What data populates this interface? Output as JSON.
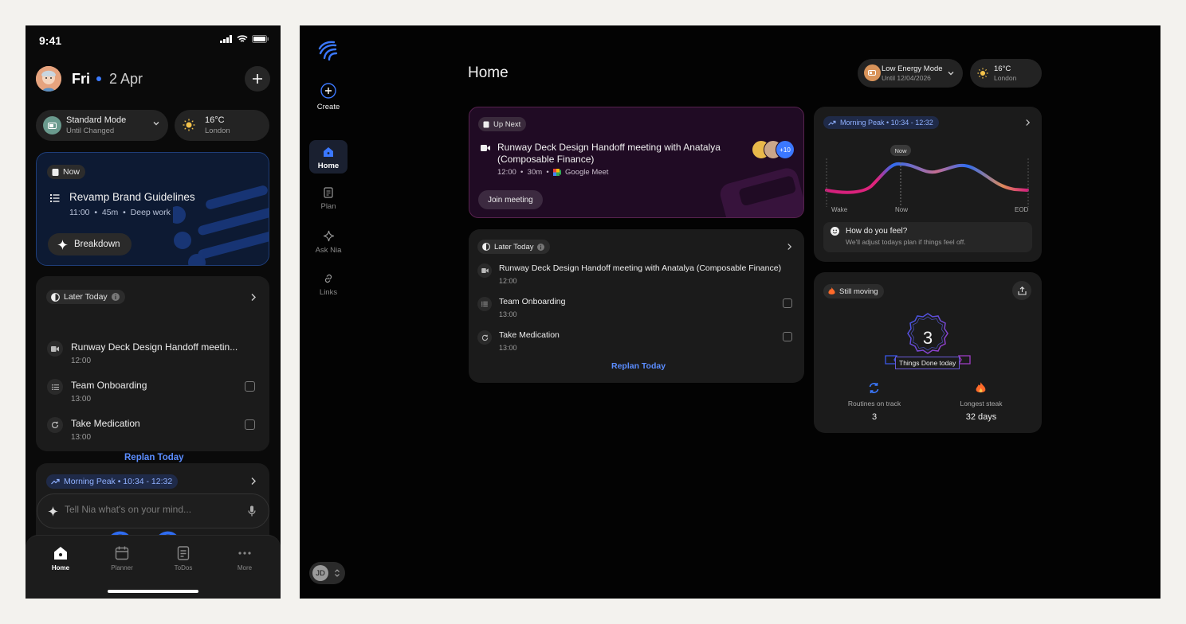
{
  "mobile": {
    "status": {
      "time": "9:41"
    },
    "header": {
      "day": "Fri",
      "date": "2 Apr"
    },
    "mode": {
      "label": "Standard Mode",
      "sub": "Until Changed"
    },
    "weather": {
      "temp": "16°C",
      "city": "London"
    },
    "now_card": {
      "tag": "Now",
      "title": "Revamp Brand Guidelines",
      "time": "11:00",
      "duration": "45m",
      "category": "Deep work",
      "button": "Breakdown"
    },
    "later": {
      "tag": "Later Today",
      "items": [
        {
          "title": "Runway Deck Design Handoff meetin...",
          "time": "12:00"
        },
        {
          "title": "Team Onboarding",
          "time": "13:00"
        },
        {
          "title": "Take Medication",
          "time": "13:00"
        }
      ],
      "replan": "Replan Today"
    },
    "peak": {
      "tag": "Morning Peak • 10:34 - 12:32"
    },
    "input": {
      "placeholder": "Tell Nia what's on your mind..."
    },
    "tabs": [
      {
        "label": "Home"
      },
      {
        "label": "Planner"
      },
      {
        "label": "ToDos"
      },
      {
        "label": "More"
      }
    ]
  },
  "desktop": {
    "nav": {
      "create": "Create",
      "items": [
        {
          "label": "Home"
        },
        {
          "label": "Plan"
        },
        {
          "label": "Ask Nia"
        },
        {
          "label": "Links"
        }
      ],
      "user_initials": "JD"
    },
    "page_title": "Home",
    "mode": {
      "label": "Low Energy Mode",
      "sub": "Until 12/04/2026"
    },
    "weather": {
      "temp": "16°C",
      "city": "London"
    },
    "up_next": {
      "tag": "Up Next",
      "title_line1": "Runway Deck Design Handoff meeting with Anatalya",
      "title_line2": "(Composable Finance)",
      "time": "12:00",
      "duration": "30m",
      "platform": "Google Meet",
      "attendees_more": "+10",
      "button": "Join meeting"
    },
    "later": {
      "tag": "Later Today",
      "items": [
        {
          "title": "Runway Deck Design Handoff meeting with Anatalya (Composable Finance)",
          "time": "12:00"
        },
        {
          "title": "Team Onboarding",
          "time": "13:00"
        },
        {
          "title": "Take Medication",
          "time": "13:00"
        }
      ],
      "replan": "Replan Today"
    },
    "peak": {
      "tag": "Morning Peak • 10:34 - 12:32",
      "now_bubble": "Now",
      "axis": {
        "start": "Wake",
        "mid": "Now",
        "end": "EOD"
      },
      "feel_title": "How do you feel?",
      "feel_sub": "We'll adjust todays plan if things feel off."
    },
    "still_moving": {
      "tag": "Still moving",
      "count": "3",
      "ribbon": "Things Done today",
      "stats": [
        {
          "label": "Routines on track",
          "value": "3"
        },
        {
          "label": "Longest steak",
          "value": "32 days"
        }
      ]
    }
  }
}
